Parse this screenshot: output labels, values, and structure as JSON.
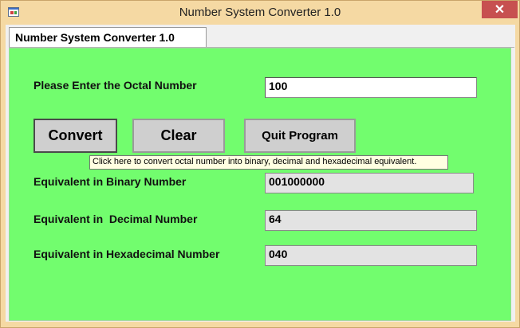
{
  "window": {
    "title": "Number System Converter 1.0",
    "close_glyph": "✕"
  },
  "tab": {
    "label": "Number System Converter 1.0"
  },
  "form": {
    "octal_label": "Please Enter the Octal Number",
    "octal_value": "100",
    "binary_label": "Equivalent in Binary Number",
    "binary_value": "001000000",
    "decimal_label": "Equivalent in  Decimal Number",
    "decimal_value": "64",
    "hex_label": "Equivalent in Hexadecimal Number",
    "hex_value": "040"
  },
  "buttons": {
    "convert": "Convert",
    "clear": "Clear",
    "quit": "Quit Program"
  },
  "tooltip": "Click here to convert octal number into binary, decimal and hexadecimal equivalent.",
  "colors": {
    "panel_background": "#72fd6e",
    "titlebar": "#f5d9a3",
    "close_button": "#c75050",
    "tooltip_background": "#ffffe1"
  },
  "icons": {
    "app": "app-window-icon",
    "close": "close-icon"
  }
}
